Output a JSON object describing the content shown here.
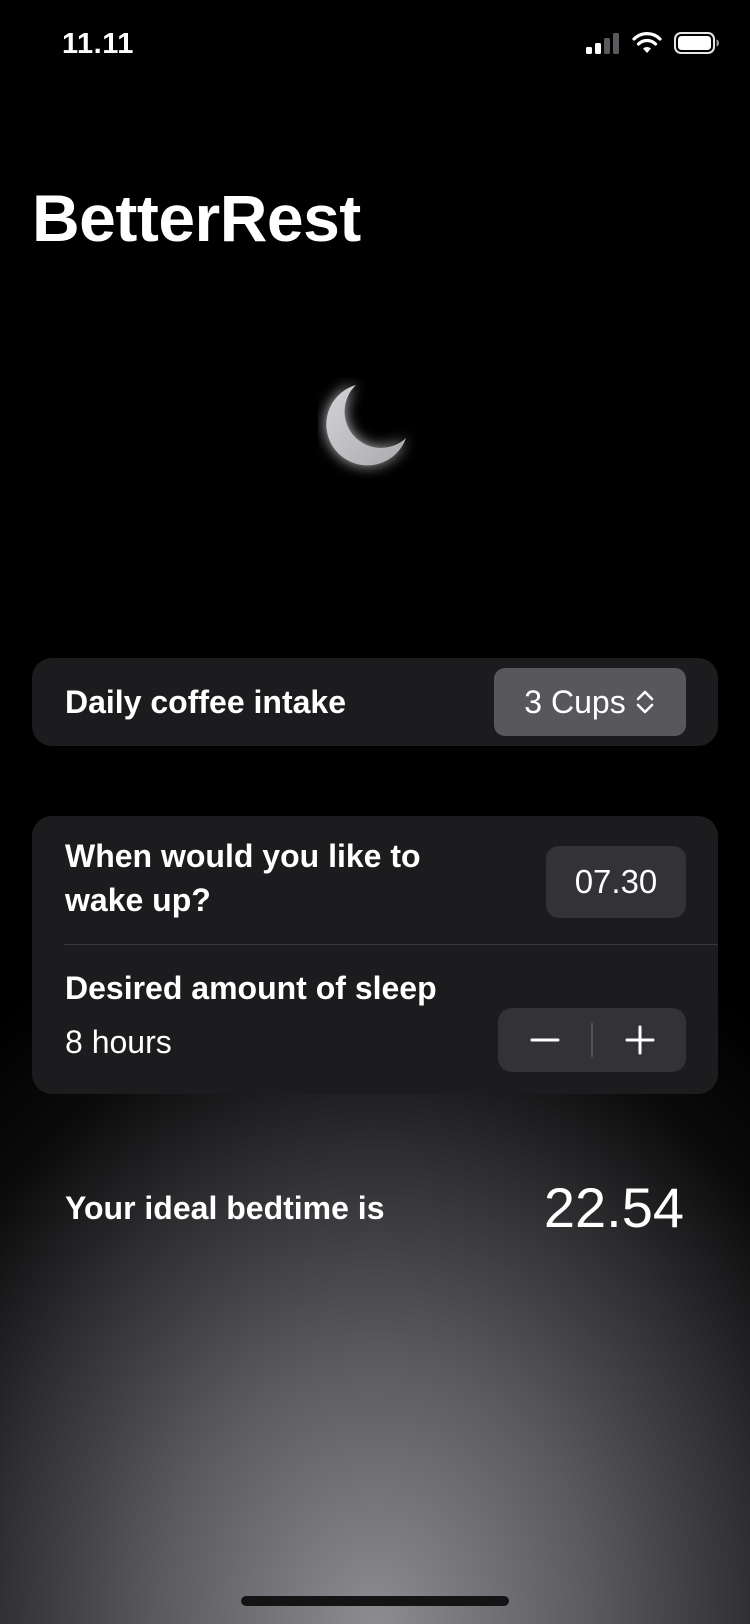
{
  "status_bar": {
    "time": "11.11",
    "icons": [
      "cellular-signal-icon",
      "wifi-icon",
      "battery-icon"
    ]
  },
  "app": {
    "title": "BetterRest",
    "hero_icon": "moon-icon"
  },
  "coffee": {
    "label": "Daily coffee intake",
    "selected_value": "3 Cups",
    "picker_icon": "chevron-up-down-icon"
  },
  "wake_up": {
    "label": "When would you like to wake up?",
    "time_value": "07.30"
  },
  "sleep": {
    "label": "Desired amount of sleep",
    "value": "8 hours",
    "decrement_icon": "minus-icon",
    "increment_icon": "plus-icon"
  },
  "result": {
    "label": "Your ideal bedtime is",
    "bedtime": "22.54"
  },
  "colors": {
    "background": "#000000",
    "card": "#1c1c1e",
    "picker_button": "#58585c",
    "chip": "#333337",
    "text": "#ffffff"
  }
}
